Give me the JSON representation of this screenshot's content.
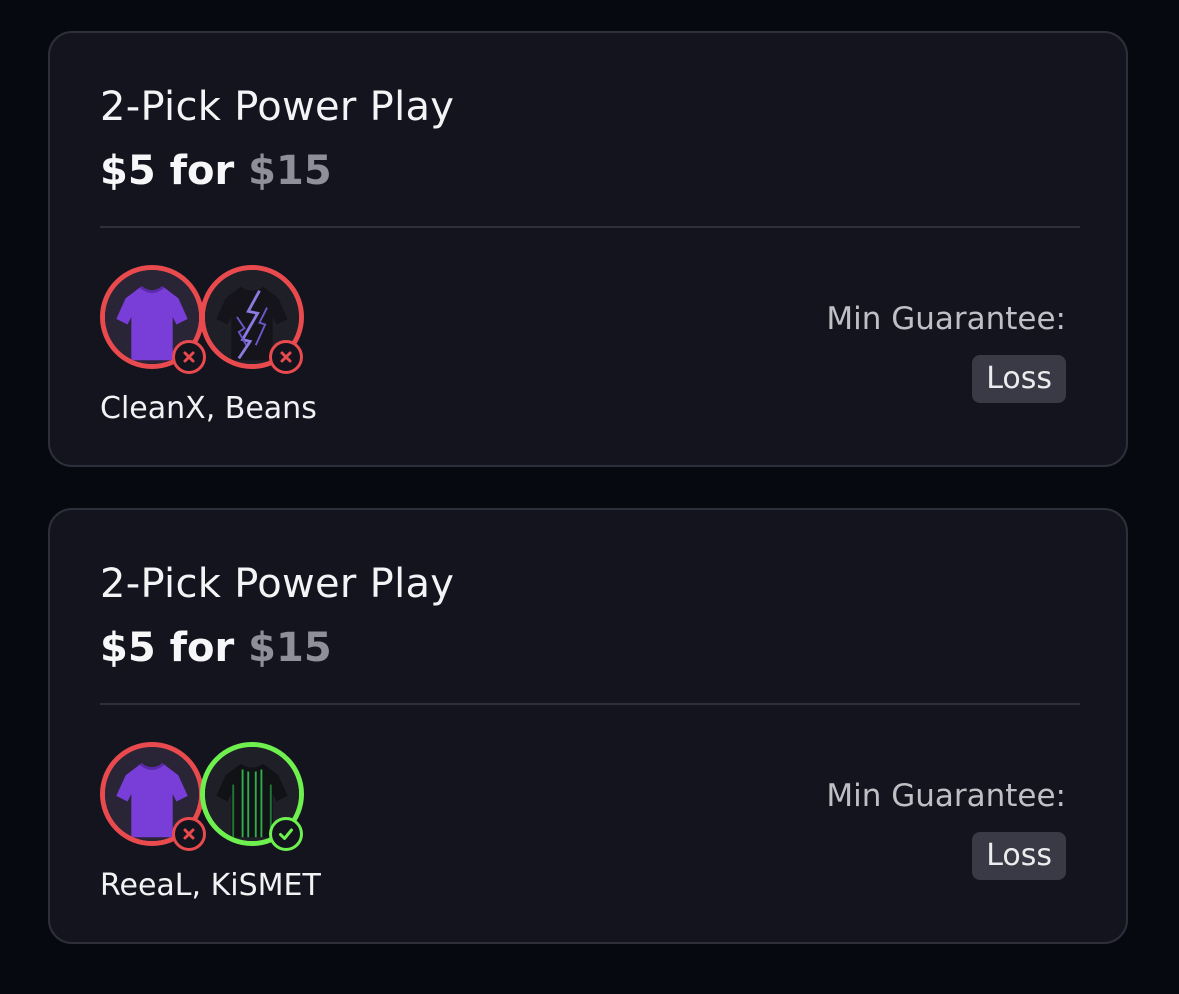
{
  "entries": [
    {
      "title": "2-Pick Power Play",
      "entry": "$5",
      "for_word": "for",
      "payout": "$15",
      "players": "CleanX, Beans",
      "picks": [
        {
          "result": "loss",
          "jersey": "purple-jersey-icon",
          "badge": "x-icon"
        },
        {
          "result": "loss",
          "jersey": "black-lightning-jersey-icon",
          "badge": "x-icon"
        }
      ],
      "min_label": "Min Guarantee:",
      "status": "Loss"
    },
    {
      "title": "2-Pick Power Play",
      "entry": "$5",
      "for_word": "for",
      "payout": "$15",
      "players": "ReeaL, KiSMET",
      "picks": [
        {
          "result": "loss",
          "jersey": "purple-jersey-icon",
          "badge": "x-icon"
        },
        {
          "result": "win",
          "jersey": "black-green-stripe-jersey-icon",
          "badge": "check-icon"
        }
      ],
      "min_label": "Min Guarantee:",
      "status": "Loss"
    }
  ],
  "colors": {
    "background": "#070911",
    "card": "#13141d",
    "loss": "#e84a4e",
    "win": "#6ef04e",
    "muted_price": "#8e8f98"
  }
}
